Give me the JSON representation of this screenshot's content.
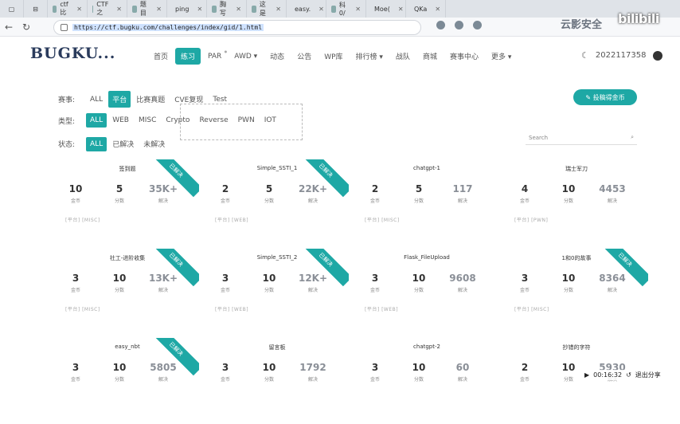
{
  "browser": {
    "tabs": [
      {
        "label": "ctf比"
      },
      {
        "label": "CTF之"
      },
      {
        "label": "题目"
      },
      {
        "label": "ping"
      },
      {
        "label": "胸写"
      },
      {
        "label": "这是"
      },
      {
        "label": "easy."
      },
      {
        "label": "科0/"
      },
      {
        "label": "Moe("
      },
      {
        "label": "QKa"
      }
    ],
    "url": "https://ctf.bugku.com/challenges/index/gid/1.html",
    "watermark_text": "云影安全",
    "watermark_logo": "bilibili"
  },
  "site": {
    "logo": "BUGKU...",
    "nav": [
      {
        "label": "首页"
      },
      {
        "label": "练习",
        "active": true
      },
      {
        "label": "PAR"
      },
      {
        "label": "AWD ▾"
      },
      {
        "label": "动态"
      },
      {
        "label": "公告"
      },
      {
        "label": "WP库"
      },
      {
        "label": "排行榜 ▾"
      },
      {
        "label": "战队"
      },
      {
        "label": "商城"
      },
      {
        "label": "赛事中心"
      },
      {
        "label": "更多 ▾"
      }
    ],
    "username": "2022117358"
  },
  "filters": {
    "event": {
      "label": "赛事:",
      "options": [
        "ALL",
        "平台",
        "比赛真题",
        "CVE复现",
        "Test"
      ],
      "active": 1
    },
    "type": {
      "label": "类型:",
      "options": [
        "ALL",
        "WEB",
        "MISC",
        "Crypto",
        "Reverse",
        "PWN",
        "IOT"
      ],
      "active": 0
    },
    "status": {
      "label": "状态:",
      "options": [
        "ALL",
        "已解决",
        "未解决"
      ],
      "active": 0
    }
  },
  "submit_button": "✎ 投稿得金币",
  "search_placeholder": "Search",
  "stat_labels": {
    "coins": "金币",
    "points": "分数",
    "solves": "解决"
  },
  "challenges": [
    {
      "title": "签到题",
      "coins": "10",
      "points": "5",
      "solves": "35K+",
      "tags": "[平台] [MISC]",
      "solved": true
    },
    {
      "title": "Simple_SSTI_1",
      "coins": "2",
      "points": "5",
      "solves": "22K+",
      "tags": "[平台] [WEB]",
      "solved": true
    },
    {
      "title": "chatgpt-1",
      "coins": "2",
      "points": "5",
      "solves": "117",
      "tags": "[平台] [MISC]",
      "solved": false
    },
    {
      "title": "瑞士军刀",
      "coins": "4",
      "points": "10",
      "solves": "4453",
      "tags": "[平台] [PWN]",
      "solved": false
    },
    {
      "title": "社工-进阶收集",
      "coins": "3",
      "points": "10",
      "solves": "13K+",
      "tags": "[平台] [MISC]",
      "solved": true
    },
    {
      "title": "Simple_SSTI_2",
      "coins": "3",
      "points": "10",
      "solves": "12K+",
      "tags": "[平台] [WEB]",
      "solved": true
    },
    {
      "title": "Flask_FileUpload",
      "coins": "3",
      "points": "10",
      "solves": "9608",
      "tags": "[平台] [WEB]",
      "solved": false
    },
    {
      "title": "1和0的故事",
      "coins": "3",
      "points": "10",
      "solves": "8364",
      "tags": "[平台] [MISC]",
      "solved": true
    },
    {
      "title": "easy_nbt",
      "coins": "3",
      "points": "10",
      "solves": "5805",
      "tags": "",
      "solved": true
    },
    {
      "title": "留言板",
      "coins": "3",
      "points": "10",
      "solves": "1792",
      "tags": "",
      "solved": false
    },
    {
      "title": "chatgpt-2",
      "coins": "3",
      "points": "10",
      "solves": "60",
      "tags": "",
      "solved": false
    },
    {
      "title": "抄错的字符",
      "coins": "2",
      "points": "10",
      "solves": "5930",
      "tags": "",
      "solved": false
    }
  ],
  "solved_label": "已解决",
  "video": {
    "time": "00:16:32",
    "exit_label": "退出分享"
  }
}
